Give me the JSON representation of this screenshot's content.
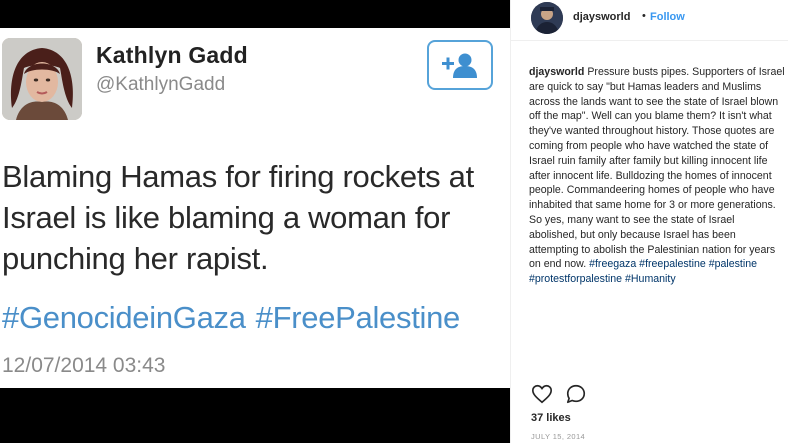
{
  "tweet": {
    "name": "Kathlyn Gadd",
    "handle": "@KathlynGadd",
    "text": "Blaming Hamas for firing rockets at Israel is like blaming a woman for punching her rapist.",
    "hashtags": [
      "#GenocideinGaza",
      "#FreePalestine"
    ],
    "timestamp": "12/07/2014 03:43",
    "follow_icon": "add-user-icon",
    "accent_color": "#4a8fc9"
  },
  "post": {
    "username": "djaysworld",
    "separator": "•",
    "follow_label": "Follow",
    "caption_text": "Pressure busts pipes. Supporters of Israel are quick to say \"but Hamas leaders and Muslims across the lands want to see the state of Israel blown off the map\". Well can you blame them? It isn't what they've wanted throughout history. Those quotes are coming from people who have watched the state of Israel ruin family after family but killing innocent life after innocent life. Bulldozing the homes of innocent people. Commandeering homes of people who have inhabited that same home for 3 or more generations. So yes, many want to see the state of Israel abolished, but only because Israel has been attempting to abolish the Palestinian nation for years on end now.",
    "caption_tags": [
      "#freegaza",
      "#freepalestine",
      "#palestine",
      "#protestforpalestine",
      "#Humanity"
    ],
    "likes": "37 likes",
    "date": "JULY 15, 2014",
    "action_icons": [
      "heart-icon",
      "comment-icon"
    ],
    "link_color": "#3897f0"
  }
}
